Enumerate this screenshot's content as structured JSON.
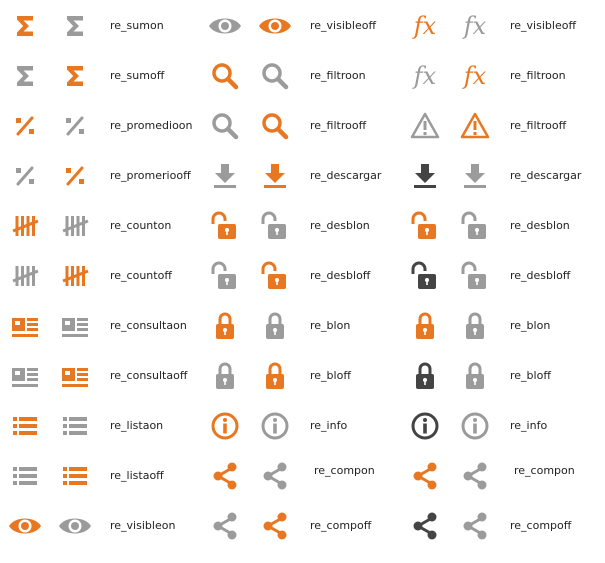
{
  "colors": {
    "orange": "#E87722",
    "gray": "#9B9B9B",
    "dark": "#444444"
  },
  "columns": [
    {
      "rows": [
        {
          "label": "re_sumon",
          "icons": [
            {
              "name": "sigma-icon",
              "color": "orange"
            },
            {
              "name": "sigma-icon",
              "color": "gray"
            }
          ]
        },
        {
          "label": "re_sumoff",
          "icons": [
            {
              "name": "sigma-icon",
              "color": "gray"
            },
            {
              "name": "sigma-icon",
              "color": "orange"
            }
          ]
        },
        {
          "label": "re_promedioon",
          "icons": [
            {
              "name": "percent-icon",
              "color": "orange"
            },
            {
              "name": "percent-icon",
              "color": "gray"
            }
          ]
        },
        {
          "label": "re_promeriooff",
          "icons": [
            {
              "name": "percent-icon",
              "color": "gray"
            },
            {
              "name": "percent-icon",
              "color": "orange"
            }
          ]
        },
        {
          "label": "re_counton",
          "icons": [
            {
              "name": "tally-icon",
              "color": "orange"
            },
            {
              "name": "tally-icon",
              "color": "gray"
            }
          ]
        },
        {
          "label": "re_countoff",
          "icons": [
            {
              "name": "tally-icon",
              "color": "gray"
            },
            {
              "name": "tally-icon",
              "color": "orange"
            }
          ]
        },
        {
          "label": "re_consultaon",
          "icons": [
            {
              "name": "consulta-icon",
              "color": "orange"
            },
            {
              "name": "consulta-icon",
              "color": "gray"
            }
          ]
        },
        {
          "label": "re_consultaoff",
          "icons": [
            {
              "name": "consulta-icon",
              "color": "gray"
            },
            {
              "name": "consulta-icon",
              "color": "orange"
            }
          ]
        },
        {
          "label": "re_listaon",
          "icons": [
            {
              "name": "list-icon",
              "color": "orange"
            },
            {
              "name": "list-icon",
              "color": "gray"
            }
          ]
        },
        {
          "label": "re_listaoff",
          "icons": [
            {
              "name": "list-icon",
              "color": "gray"
            },
            {
              "name": "list-icon",
              "color": "orange"
            }
          ]
        },
        {
          "label": "re_visibleon",
          "icons": [
            {
              "name": "eye-icon",
              "color": "orange"
            },
            {
              "name": "eye-icon",
              "color": "gray"
            }
          ]
        }
      ]
    },
    {
      "rows": [
        {
          "label": "re_visibleoff",
          "icons": [
            {
              "name": "eye-icon",
              "color": "gray"
            },
            {
              "name": "eye-icon",
              "color": "orange"
            }
          ]
        },
        {
          "label": "re_filtroon",
          "icons": [
            {
              "name": "search-icon",
              "color": "orange"
            },
            {
              "name": "search-icon",
              "color": "gray"
            }
          ]
        },
        {
          "label": "re_filtrooff",
          "icons": [
            {
              "name": "search-icon",
              "color": "gray"
            },
            {
              "name": "search-icon",
              "color": "orange"
            }
          ]
        },
        {
          "label": "re_descargar",
          "icons": [
            {
              "name": "download-icon",
              "color": "gray"
            },
            {
              "name": "download-icon",
              "color": "orange"
            }
          ]
        },
        {
          "label": "re_desblon",
          "icons": [
            {
              "name": "unlock-icon",
              "color": "orange"
            },
            {
              "name": "unlock-icon",
              "color": "gray"
            }
          ]
        },
        {
          "label": "re_desbloff",
          "icons": [
            {
              "name": "unlock-icon",
              "color": "gray"
            },
            {
              "name": "unlock-icon",
              "color": "orange"
            }
          ]
        },
        {
          "label": "re_blon",
          "icons": [
            {
              "name": "lock-icon",
              "color": "orange"
            },
            {
              "name": "lock-icon",
              "color": "gray"
            }
          ]
        },
        {
          "label": "re_bloff",
          "icons": [
            {
              "name": "lock-icon",
              "color": "gray"
            },
            {
              "name": "lock-icon",
              "color": "orange"
            }
          ]
        },
        {
          "label": "re_info",
          "icons": [
            {
              "name": "info-icon",
              "color": "orange"
            },
            {
              "name": "info-icon",
              "color": "gray"
            }
          ]
        },
        {
          "label": "re_compon",
          "icons": [
            {
              "name": "share-icon",
              "color": "orange"
            },
            {
              "name": "share-icon",
              "color": "gray"
            }
          ]
        },
        {
          "label": "re_compoff",
          "icons": [
            {
              "name": "share-icon",
              "color": "gray"
            },
            {
              "name": "share-icon",
              "color": "orange"
            }
          ]
        }
      ]
    },
    {
      "rows": [
        {
          "label": "re_visibleoff",
          "icons": [
            {
              "name": "fx-icon",
              "color": "orange",
              "text": "fx"
            },
            {
              "name": "fx-icon",
              "color": "gray",
              "text": "fx"
            }
          ]
        },
        {
          "label": "re_filtroon",
          "icons": [
            {
              "name": "fx-icon",
              "color": "gray",
              "text": "fx"
            },
            {
              "name": "fx-icon",
              "color": "orange",
              "text": "fx"
            }
          ]
        },
        {
          "label": "re_filtrooff",
          "icons": [
            {
              "name": "warning-icon",
              "color": "gray"
            },
            {
              "name": "warning-icon",
              "color": "orange"
            }
          ]
        },
        {
          "label": "re_descargar",
          "icons": [
            {
              "name": "download-icon",
              "color": "dark"
            },
            {
              "name": "download-icon",
              "color": "gray"
            }
          ]
        },
        {
          "label": "re_desblon",
          "icons": [
            {
              "name": "unlock-icon",
              "color": "orange"
            },
            {
              "name": "unlock-icon",
              "color": "gray"
            }
          ]
        },
        {
          "label": "re_desbloff",
          "icons": [
            {
              "name": "unlock-icon",
              "color": "dark"
            },
            {
              "name": "unlock-icon",
              "color": "gray"
            }
          ]
        },
        {
          "label": "re_blon",
          "icons": [
            {
              "name": "lock-icon",
              "color": "orange"
            },
            {
              "name": "lock-icon",
              "color": "gray"
            }
          ]
        },
        {
          "label": "re_bloff",
          "icons": [
            {
              "name": "lock-icon",
              "color": "dark"
            },
            {
              "name": "lock-icon",
              "color": "gray"
            }
          ]
        },
        {
          "label": "re_info",
          "icons": [
            {
              "name": "info-icon",
              "color": "dark"
            },
            {
              "name": "info-icon",
              "color": "gray"
            }
          ]
        },
        {
          "label": "re_compon",
          "icons": [
            {
              "name": "share-icon",
              "color": "orange"
            },
            {
              "name": "share-icon",
              "color": "gray"
            }
          ]
        },
        {
          "label": "re_compoff",
          "icons": [
            {
              "name": "share-icon",
              "color": "dark"
            },
            {
              "name": "share-icon",
              "color": "gray"
            }
          ]
        }
      ]
    }
  ]
}
